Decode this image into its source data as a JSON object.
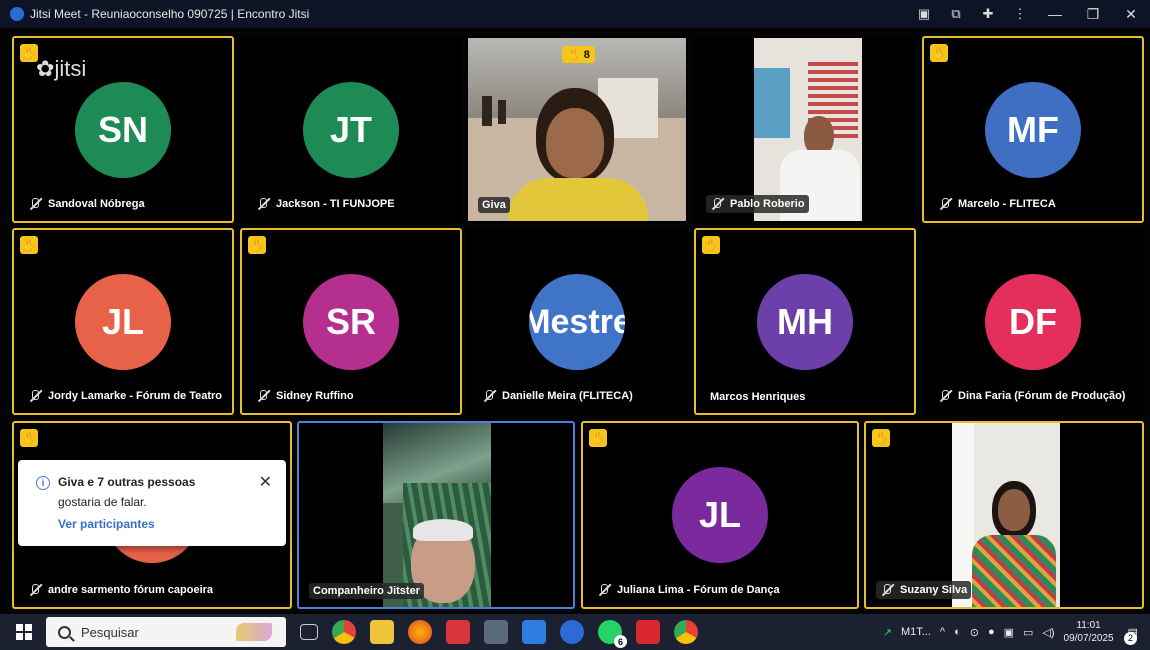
{
  "window": {
    "title": "Jitsi Meet - Reuniaoconselho 090725 | Encontro Jitsi",
    "controls": [
      "camera-icon",
      "share-icon",
      "extension-icon",
      "more-icon",
      "minimize-icon",
      "restore-icon",
      "close-icon"
    ]
  },
  "brand": {
    "logo_text": "jitsi"
  },
  "participants": [
    {
      "name": "Sandoval Nóbrega",
      "initials": "SN",
      "color": "#1e8a55",
      "hand_raised": true,
      "muted": true
    },
    {
      "name": "Jackson - TI FUNJOPE",
      "initials": "JT",
      "color": "#1e8a55",
      "hand_raised": false,
      "muted": true
    },
    {
      "name": "Giva",
      "video": true,
      "hand_raised": true,
      "hand_count": "8",
      "muted": false
    },
    {
      "name": "Pablo Roberio",
      "video": true,
      "hand_raised": false,
      "muted": true
    },
    {
      "name": "Marcelo - FLITECA",
      "initials": "MF",
      "color": "#3f6fc2",
      "hand_raised": true,
      "muted": true
    },
    {
      "name": "Jordy Lamarke - Fórum de Teatro",
      "initials": "JL",
      "color": "#e8624a",
      "hand_raised": true,
      "muted": true
    },
    {
      "name": "Sidney Ruffino",
      "initials": "SR",
      "color": "#b52f8e",
      "hand_raised": true,
      "muted": true
    },
    {
      "name": "Danielle Meira (FLITECA)",
      "initials": "Mestre",
      "color": "#3f74c6",
      "hand_raised": false,
      "muted": true
    },
    {
      "name": "Marcos Henriques",
      "initials": "MH",
      "color": "#6c40a8",
      "hand_raised": true,
      "muted": false
    },
    {
      "name": "Dina Faria (Fórum de Produção)",
      "initials": "DF",
      "color": "#e42f5c",
      "hand_raised": false,
      "muted": true
    },
    {
      "name": "andre sarmento fórum capoeira",
      "initials": "",
      "color": "#e8624a",
      "hand_raised": true,
      "muted": true
    },
    {
      "name": "Companheiro Jitster",
      "video": true,
      "hand_raised": false,
      "muted": false,
      "active_speaker": true
    },
    {
      "name": "Juliana Lima - Fórum de Dança",
      "initials": "JL",
      "color": "#7b2a9e",
      "hand_raised": true,
      "muted": true
    },
    {
      "name": "Suzany Silva",
      "video": true,
      "hand_raised": true,
      "muted": true
    }
  ],
  "notification": {
    "title": "Giva e 7 outras pessoas",
    "message": "gostaria de falar.",
    "action": "Ver participantes"
  },
  "taskbar": {
    "search_placeholder": "Pesquisar",
    "apps": [
      "task-view-icon",
      "chrome-icon",
      "file-explorer-icon",
      "firefox-icon",
      "app-red-icon",
      "calculator-icon",
      "app-blue-icon",
      "jitsi-icon",
      "whatsapp-icon",
      "acrobat-icon",
      "chrome-icon"
    ],
    "whatsapp_badge": "6",
    "stock_label": "M1T...",
    "time": "11:01",
    "date": "09/07/2025",
    "notifications_badge": "2"
  }
}
